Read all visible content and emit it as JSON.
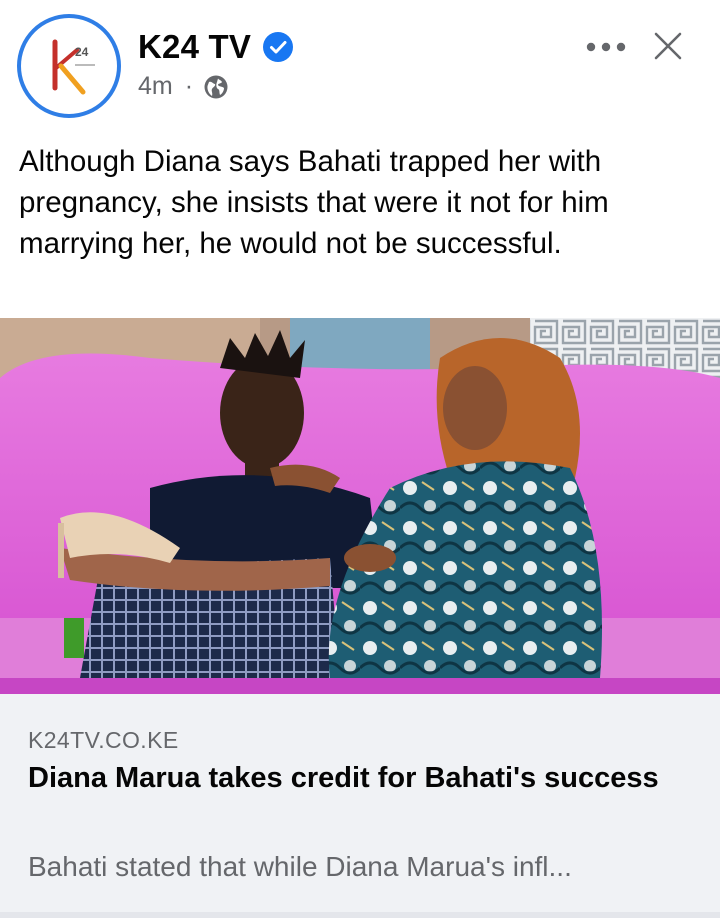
{
  "post": {
    "page_name": "K24 TV",
    "verified": true,
    "timestamp": "4m",
    "separator": "·",
    "audience_icon": "globe-icon",
    "text": "Although Diana says Bahati trapped her with pregnancy, she insists that were it not for him marrying her, he would not be successful."
  },
  "header_actions": {
    "more_icon": "more-horizontal-icon",
    "close_icon": "close-icon"
  },
  "avatar": {
    "logo_text": "24",
    "ring_color": "#2f7ee6"
  },
  "link_preview": {
    "domain": "K24TV.CO.KE",
    "title": "Diana Marua takes credit for Bahati's success",
    "description": "Bahati stated that while Diana Marua's infl..."
  },
  "colors": {
    "verified_blue": "#1877f2",
    "secondary_text": "#65676b",
    "card_background": "#f0f2f5"
  }
}
